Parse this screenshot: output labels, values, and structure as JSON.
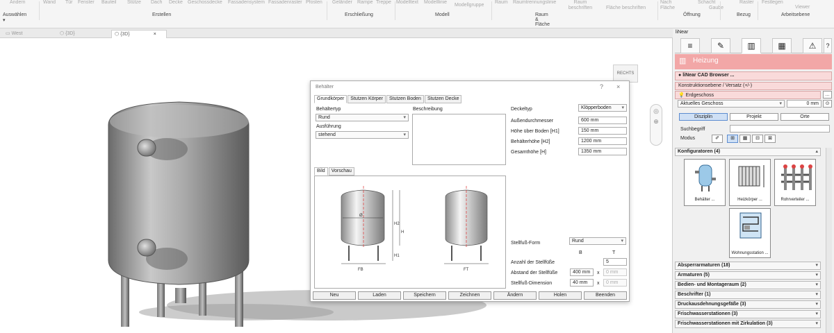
{
  "ribbon": {
    "commands": [
      "Ändern",
      "Wand",
      "Tür",
      "Fenster",
      "Bauteil",
      "Stütze",
      "Dach",
      "Decke",
      "Geschossdecke",
      "Fassadensystem",
      "Fassadenraster",
      "Pfosten",
      "Geländer",
      "Rampe",
      "Treppe",
      "Modelltext",
      "Modelllinie",
      "Modellgruppe",
      "Raum",
      "Raumtrennungslinie",
      "Raum beschriften",
      "Fläche beschriften",
      "Nach Fläche",
      "Schacht",
      "Gaube",
      "Raster",
      "Festlegen",
      "Viewer"
    ],
    "groups": [
      "Auswählen",
      "Erstellen",
      "Erschließung",
      "Modell",
      "Raum & Fläche",
      "Öffnung",
      "Bezug",
      "Arbeitsebene"
    ]
  },
  "view_tabs": [
    {
      "label": "West",
      "icon": "view-icon"
    },
    {
      "label": "{3D}",
      "icon": "view-3d-icon"
    },
    {
      "label": "{3D}",
      "icon": "view-3d-icon",
      "close": "×"
    }
  ],
  "viewcube_label": "RECHTS",
  "dialog": {
    "title": "Behälter",
    "help": "?",
    "close": "×",
    "tabs": [
      "Grundkörper",
      "Stutzen Körper",
      "Stutzen Boden",
      "Stutzen Decke"
    ],
    "behaeltertyp_label": "Behältertyp",
    "behaeltertyp_value": "Rund",
    "ausfuehrung_label": "Ausführung",
    "ausfuehrung_value": "stehend",
    "beschreibung_label": "Beschreibung",
    "deckeltyp_label": "Deckeltyp",
    "deckeltyp_value": "Klöpperboden",
    "params": [
      {
        "label": "Außendurchmesser",
        "value": "600 mm"
      },
      {
        "label": "Höhe über Boden [H1]",
        "value": "150 mm"
      },
      {
        "label": "Behälterhöhe [H2]",
        "value": "1200 mm"
      },
      {
        "label": "Gesamthöhe [H]",
        "value": "1350 mm"
      }
    ],
    "image_tabs": [
      "Bild",
      "Vorschau"
    ],
    "diagram_labels": {
      "fb": "FB",
      "ft": "FT",
      "h": "H",
      "h1": "H1",
      "h2": "H2",
      "diameter": "Ø"
    },
    "stellfuss_form_label": "Stellfuß-Form",
    "stellfuss_form_value": "Rund",
    "col_b": "B",
    "col_t": "T",
    "anzahl_label": "Anzahl der Stellfüße",
    "anzahl_value": "5",
    "abstand_label": "Abstand der Stellfüße",
    "abstand_b": "400 mm",
    "abstand_t": "0 mm",
    "dimension_label": "Stellfuß-Dimension",
    "dimension_b": "40 mm",
    "dimension_t": "0 mm",
    "times": "x",
    "buttons": [
      "Neu",
      "Laden",
      "Speichern",
      "Zeichnen",
      "Ändern",
      "Holen",
      "Beenden"
    ]
  },
  "panel": {
    "title": "liNear",
    "heizung": "Heizung",
    "cad_browser": "liNear CAD Browser ...",
    "konstruktionsebene": "Konstruktionsebene / Versatz (+/-)",
    "geschoss": "Erdgeschoss",
    "aktuelles": "Aktuelles Geschoss",
    "offset": "0 mm",
    "disziplin": "Disziplin",
    "projekt": "Projekt",
    "orte": "Orte",
    "suchbegriff": "Suchbegriff",
    "modus": "Modus",
    "konfiguratoren": "Konfiguratoren (4)",
    "configurators": [
      "Behälter ...",
      "Heizkörper ...",
      "Rohrverteiler ...",
      "Wohnungsstation ..."
    ],
    "sections": [
      "Absperrarmaturen (18)",
      "Armaturen (5)",
      "Bedien- und Montageraum (2)",
      "Beschrifter (1)",
      "Druckausdehnungsgefäße (3)",
      "Frischwasserstationen (3)",
      "Frischwasserstationen mit Zirkulation (3)"
    ]
  },
  "colors": {
    "accent_pink": "#f2a7a7",
    "accent_pink_light": "#f9dada",
    "selected_blue": "#cfe0f5"
  }
}
